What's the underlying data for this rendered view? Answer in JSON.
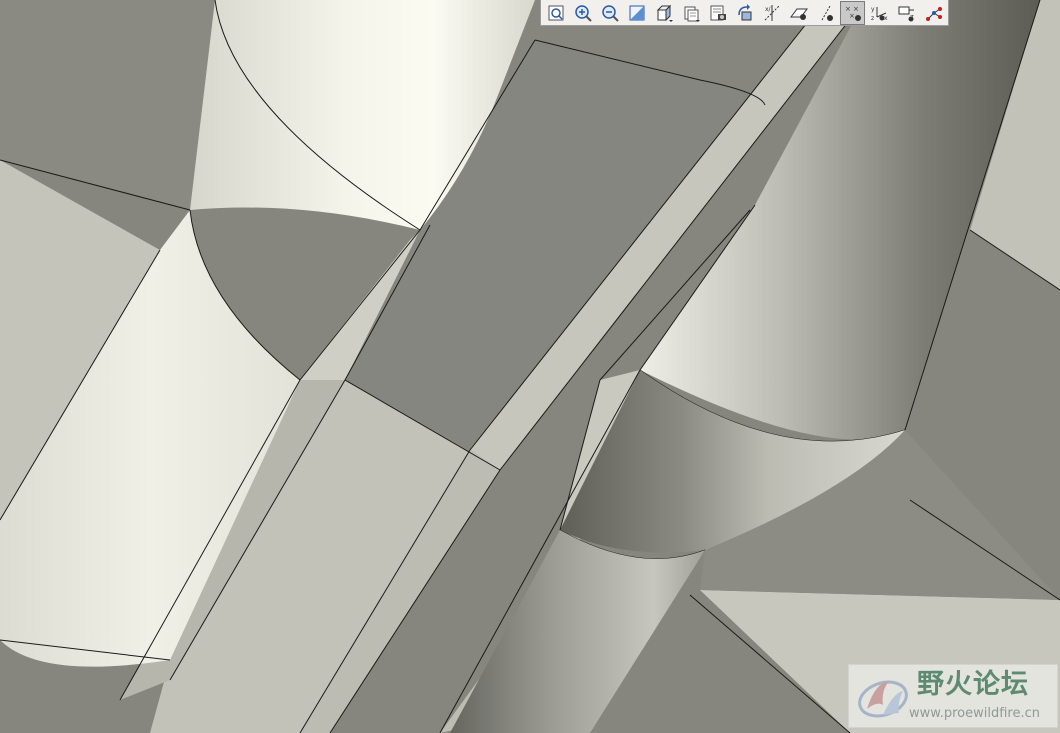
{
  "viewport": {
    "model_color": "#bfbfb6",
    "edge_color": "#1a1a1a",
    "background_color": "#8a8a82"
  },
  "toolbar": {
    "buttons": [
      {
        "id": "refit",
        "icon": "refit-icon",
        "active": false
      },
      {
        "id": "zoom-in",
        "icon": "zoom-in-icon",
        "active": false
      },
      {
        "id": "zoom-out",
        "icon": "zoom-out-icon",
        "active": false
      },
      {
        "id": "repaint",
        "icon": "repaint-icon",
        "active": false
      },
      {
        "id": "display-style",
        "icon": "display-style-icon",
        "active": false
      },
      {
        "id": "saved-views",
        "icon": "saved-views-icon",
        "active": false
      },
      {
        "id": "view-manager",
        "icon": "view-manager-icon",
        "active": false
      },
      {
        "id": "spin-center",
        "icon": "spin-center-icon",
        "active": false
      },
      {
        "id": "datum-axes",
        "icon": "datum-axes-icon",
        "active": false
      },
      {
        "id": "datum-planes",
        "icon": "datum-planes-icon",
        "active": false
      },
      {
        "id": "datum-axis-display",
        "icon": "datum-axis-display-icon",
        "active": false
      },
      {
        "id": "datum-points",
        "icon": "datum-points-icon",
        "active": true
      },
      {
        "id": "coordinate-systems",
        "icon": "coordinate-systems-icon",
        "active": false
      },
      {
        "id": "annotations",
        "icon": "annotations-icon",
        "active": false
      },
      {
        "id": "sketch",
        "icon": "sketch-icon",
        "active": false
      }
    ]
  },
  "watermark": {
    "title": "野火论坛",
    "url": "www.proewildfire.cn"
  }
}
